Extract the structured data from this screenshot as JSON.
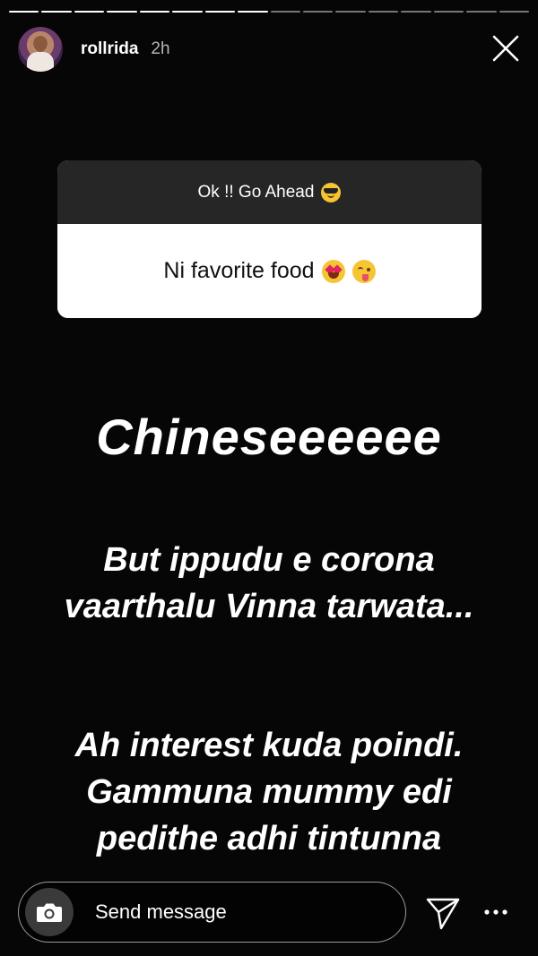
{
  "story": {
    "segments_total": 16,
    "segments_done": 8
  },
  "header": {
    "username": "rollrida",
    "time": "2h",
    "avatar_icon": "profile-avatar",
    "close_icon": "close-icon"
  },
  "question": {
    "prompt": "Ok !! Go Ahead",
    "prompt_emoji": "smiling-face-with-sunglasses",
    "answer": "Ni favorite food",
    "answer_emojis": [
      "heart-eyes-emoji",
      "yum-emoji"
    ]
  },
  "story_text": {
    "headline": "Chineseeeeee",
    "paragraph1": "But ippudu e corona vaarthalu Vinna tarwata...",
    "paragraph2": "Ah interest kuda poindi. Gammuna mummy edi pedithe adhi tintunna"
  },
  "footer": {
    "message_placeholder": "Send message",
    "camera_icon": "camera-icon",
    "send_icon": "send-icon",
    "more_icon": "more-icon"
  },
  "colors": {
    "background": "#060606",
    "card_header": "#262626",
    "card_body": "#ffffff",
    "text": "#ffffff"
  }
}
